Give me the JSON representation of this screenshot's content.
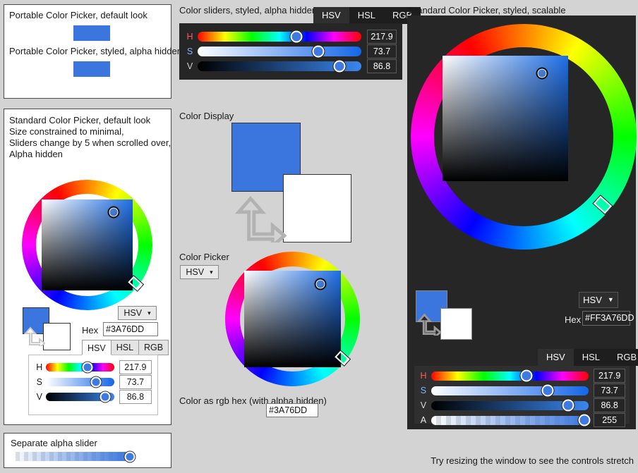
{
  "app": {
    "background_color": "#d3d3d3",
    "accent_color": "#3A76DD",
    "footer_note": "Try resizing the window to see the controls stretch"
  },
  "portable_panel": {
    "name": "portable-color-picker-panel",
    "caption_default": "Portable Color Picker, default look",
    "caption_styled": "Portable Color Picker, styled, alpha hidden",
    "swatch_default_color": "#3A76DD",
    "swatch_styled_color": "#3A76DD"
  },
  "color_sliders_panel": {
    "caption": "Color sliders, styled, alpha hidden",
    "tabs": [
      {
        "label": "HSV",
        "active": true
      },
      {
        "label": "HSL",
        "active": false
      },
      {
        "label": "RGB",
        "active": false
      }
    ],
    "sliders": [
      {
        "label": "H",
        "value": "217.9",
        "percent": 60.5,
        "type": "hue"
      },
      {
        "label": "S",
        "value": "73.7",
        "percent": 73.7,
        "type": "sat"
      },
      {
        "label": "V",
        "value": "86.8",
        "percent": 86.8,
        "type": "val"
      }
    ]
  },
  "standard_default_panel": {
    "caption_lines": "Standard Color Picker, default look\nSize constrained to minimal,\nSliders change by 5 when scrolled over,\nAlpha hidden",
    "current_color": "#3A76DD",
    "previous_color": "#FFFFFF",
    "mode_dropdown": "HSV",
    "hex_label": "Hex",
    "hex_value": "#3A76DD",
    "tabs": [
      {
        "label": "HSV",
        "active": true
      },
      {
        "label": "HSL",
        "active": false
      },
      {
        "label": "RGB",
        "active": false
      }
    ],
    "sliders": [
      {
        "label": "H",
        "value": "217.9",
        "percent": 60.5,
        "type": "hue"
      },
      {
        "label": "S",
        "value": "73.7",
        "percent": 73.7,
        "type": "sat"
      },
      {
        "label": "V",
        "value": "86.8",
        "percent": 86.8,
        "type": "val"
      }
    ],
    "wheel_hue_deg": 217.9
  },
  "separate_alpha_panel": {
    "caption": "Separate alpha slider",
    "value_percent": 100
  },
  "color_display_panel": {
    "caption": "Color Display",
    "current_color": "#3A76DD",
    "previous_color": "#FFFFFF"
  },
  "color_picker_panel": {
    "caption": "Color Picker",
    "mode_dropdown": "HSV",
    "wheel_hue_deg": 217.9
  },
  "rgb_hex_panel": {
    "caption": "Color as rgb hex (with alpha hidden)",
    "value": "#3A76DD"
  },
  "standard_styled_panel": {
    "caption": "Standard Color Picker, styled, scalable",
    "current_color": "#3A76DD",
    "previous_color": "#FFFFFF",
    "mode_dropdown": "HSV",
    "hex_label": "Hex",
    "hex_value": "#FF3A76DD",
    "tabs": [
      {
        "label": "HSV",
        "active": true
      },
      {
        "label": "HSL",
        "active": false
      },
      {
        "label": "RGB",
        "active": false
      }
    ],
    "sliders": [
      {
        "label": "H",
        "value": "217.9",
        "percent": 60.5,
        "type": "hue"
      },
      {
        "label": "S",
        "value": "73.7",
        "percent": 73.7,
        "type": "sat"
      },
      {
        "label": "V",
        "value": "86.8",
        "percent": 86.8,
        "type": "val"
      },
      {
        "label": "A",
        "value": "255",
        "percent": 100,
        "type": "alpha"
      }
    ],
    "wheel_hue_deg": 217.9
  }
}
